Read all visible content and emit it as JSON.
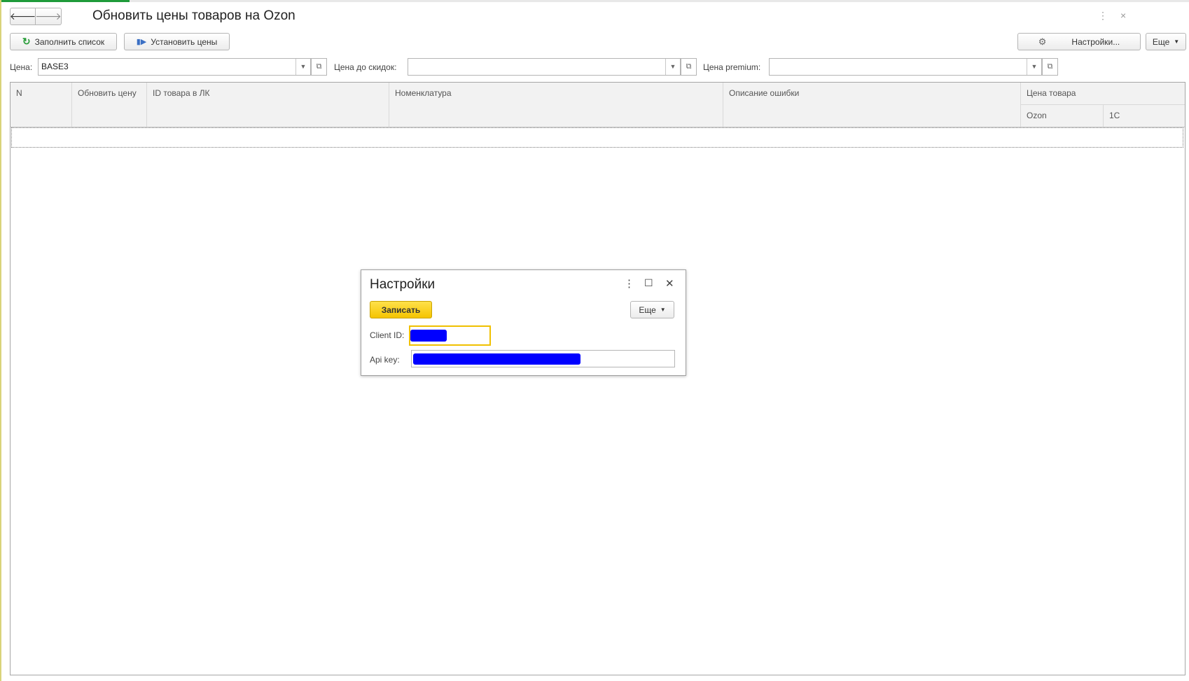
{
  "window": {
    "title": "Обновить цены товаров на Ozon",
    "more_icon": "⋮",
    "close_icon": "×"
  },
  "nav": {
    "back": "🡐",
    "forward": "🡒"
  },
  "toolbar": {
    "fill_list": "Заполнить список",
    "set_prices": "Установить цены",
    "settings": "Настройки...",
    "more": "Еще"
  },
  "filters": {
    "price_label": "Цена:",
    "price_value": "BASE3",
    "price_before_label": "Цена до скидок:",
    "price_before_value": "",
    "price_premium_label": "Цена premium:",
    "price_premium_value": ""
  },
  "table": {
    "columns": [
      "N",
      "Обновить цену",
      "ID товара в ЛК",
      "Номенклатура",
      "Описание ошибки",
      "Цена товара"
    ],
    "subcolumns": [
      "Ozon",
      "1С"
    ]
  },
  "dialog": {
    "title": "Настройки",
    "save": "Записать",
    "more": "Еще",
    "client_id_label": "Client ID:",
    "api_key_label": "Api key:"
  },
  "colors": {
    "accent_yellow": "#f5c400",
    "redaction": "#0000ff"
  }
}
